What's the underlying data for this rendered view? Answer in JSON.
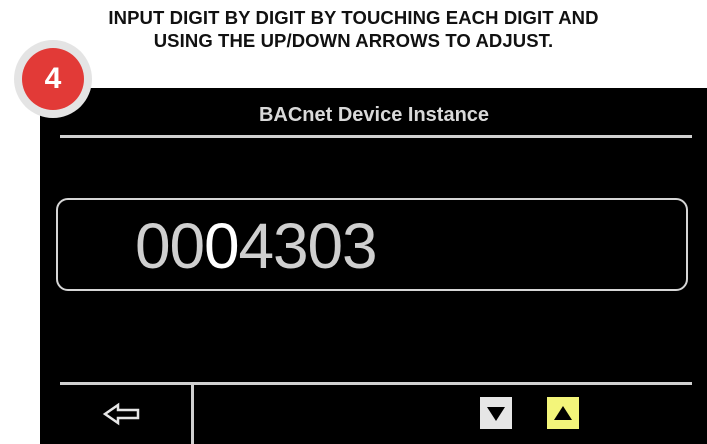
{
  "instruction": {
    "line1": "INPUT DIGIT BY DIGIT BY TOUCHING EACH DIGIT AND",
    "line2": "USING THE UP/DOWN ARROWS TO ADJUST."
  },
  "step_badge": {
    "number": "4",
    "color": "#e23a37"
  },
  "screen": {
    "title": "BACnet Device Instance",
    "digits": [
      "0",
      "0",
      "0",
      "4",
      "3",
      "0",
      "3"
    ],
    "selected_digit_index": 2
  },
  "controls": {
    "back": {
      "icon": "back-arrow-icon"
    },
    "down": {
      "icon": "down-triangle-icon",
      "color": "#e6e6e6"
    },
    "up": {
      "icon": "up-triangle-icon",
      "color": "#f3f57a"
    }
  }
}
